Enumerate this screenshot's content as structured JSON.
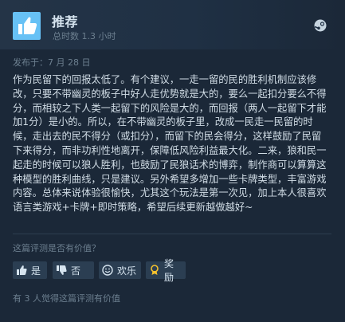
{
  "review": {
    "verdict": "推荐",
    "hours": "总时数 1.3 小时",
    "posted": "发布于：7 月 28 日",
    "body": "作为民留下的回报太低了。有个建议，一走一留的民的胜利机制应该修改，只要不带幽灵的板子中好人走优势就是大的，要么一起扣分要么不得分，而相较之下人类一起留下的风险是大的，而回报（两人一起留下才能加1分）是小的。所以，在不带幽灵的板子里，改成一民走一民留的时候，走出去的民不得分（或扣分），而留下的民会得分，这样鼓励了民留下来得分，而非功利性地离开，保障低风险利益最大化。二来，狼和民一起走的时候可以狼人胜利，也鼓励了民狼话术的博弈，制作商可以算算这种模型的胜利曲线，只是建议。另外希望多增加一些卡牌类型，丰富游戏内容。总体来说体验很愉快，尤其这个玩法是第一次见，加上本人很喜欢语言类游戏+卡牌+即时策略，希望后续更新越做越好~"
  },
  "feedback": {
    "question": "这篇评测是否有价值？",
    "yes_label": "是",
    "no_label": "否",
    "funny_label": "欢乐",
    "award_label": "奖励",
    "helpful_count_text": "有 3 人觉得这篇评测有价值"
  },
  "icons": {
    "verdict": "thumbs-up-icon",
    "platform": "steam-logo-icon",
    "yes": "thumbs-up-icon",
    "no": "thumbs-down-icon",
    "funny": "smiley-icon",
    "award": "award-icon"
  },
  "colors": {
    "background": "#1b2838",
    "recommend_icon_bg": "#67c1f5",
    "button_bg": "#2b3e52",
    "award_accent": "#f5c22d"
  }
}
